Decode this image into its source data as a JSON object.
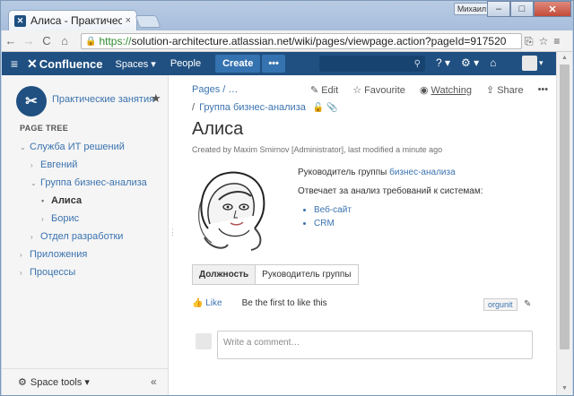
{
  "browser": {
    "tab_title": "Алиса - Практическ",
    "tab_close": "×",
    "user_chip": "Михаил",
    "url_scheme": "https://",
    "url_rest": "solution-architecture.atlassian.net/wiki/pages/viewpage.action?pageId=917520",
    "nav_back": "←",
    "nav_forward": "→",
    "reload": "C",
    "home": "⌂",
    "win_min": "–",
    "win_max": "□",
    "win_close": "✕"
  },
  "header": {
    "logo": "Confluence",
    "spaces": "Spaces ▾",
    "people": "People",
    "create": "Create",
    "more": "•••",
    "search_icon": "🔍",
    "help": "? ▾",
    "settings": "⚙ ▾",
    "notifications": "🔔"
  },
  "sidebar": {
    "space_name": "Практические занятия",
    "page_tree_heading": "PAGE TREE",
    "tree": [
      {
        "label": "Служба ИТ решений",
        "toggle": "⌄"
      },
      {
        "label": "Евгений",
        "toggle": "›"
      },
      {
        "label": "Группа бизнес-анализа",
        "toggle": "⌄"
      },
      {
        "label": "Алиса",
        "toggle": "•"
      },
      {
        "label": "Борис",
        "toggle": "›"
      },
      {
        "label": "Отдел разработки",
        "toggle": "›"
      },
      {
        "label": "Приложения",
        "toggle": "›"
      },
      {
        "label": "Процессы",
        "toggle": "›"
      }
    ],
    "space_tools": "Space tools ▾",
    "collapse": "«"
  },
  "page": {
    "breadcrumb": "Pages  /  …",
    "actions": {
      "edit": "Edit",
      "favourite": "Favourite",
      "watching": "Watching",
      "share": "Share",
      "more": "•••"
    },
    "breadcrumb2": "Группа бизнес-анализа",
    "title": "Алиса",
    "byline": "Created by Maxim Smirnov [Administrator], last modified a minute ago",
    "role_prefix": "Руководитель группы ",
    "role_link": "бизнес-анализа",
    "responsibility": "Отвечает за анализ требований к системам:",
    "systems": [
      "Веб-сайт",
      "CRM"
    ],
    "table": {
      "header": "Должность",
      "value": "Руководитель группы"
    },
    "like": "Like",
    "like_text": "Be the first to like this",
    "label": "orgunit",
    "comment_placeholder": "Write a comment…"
  },
  "colors": {
    "header_bg": "#205081",
    "link": "#3b73af",
    "create_bg": "#3572b0"
  }
}
